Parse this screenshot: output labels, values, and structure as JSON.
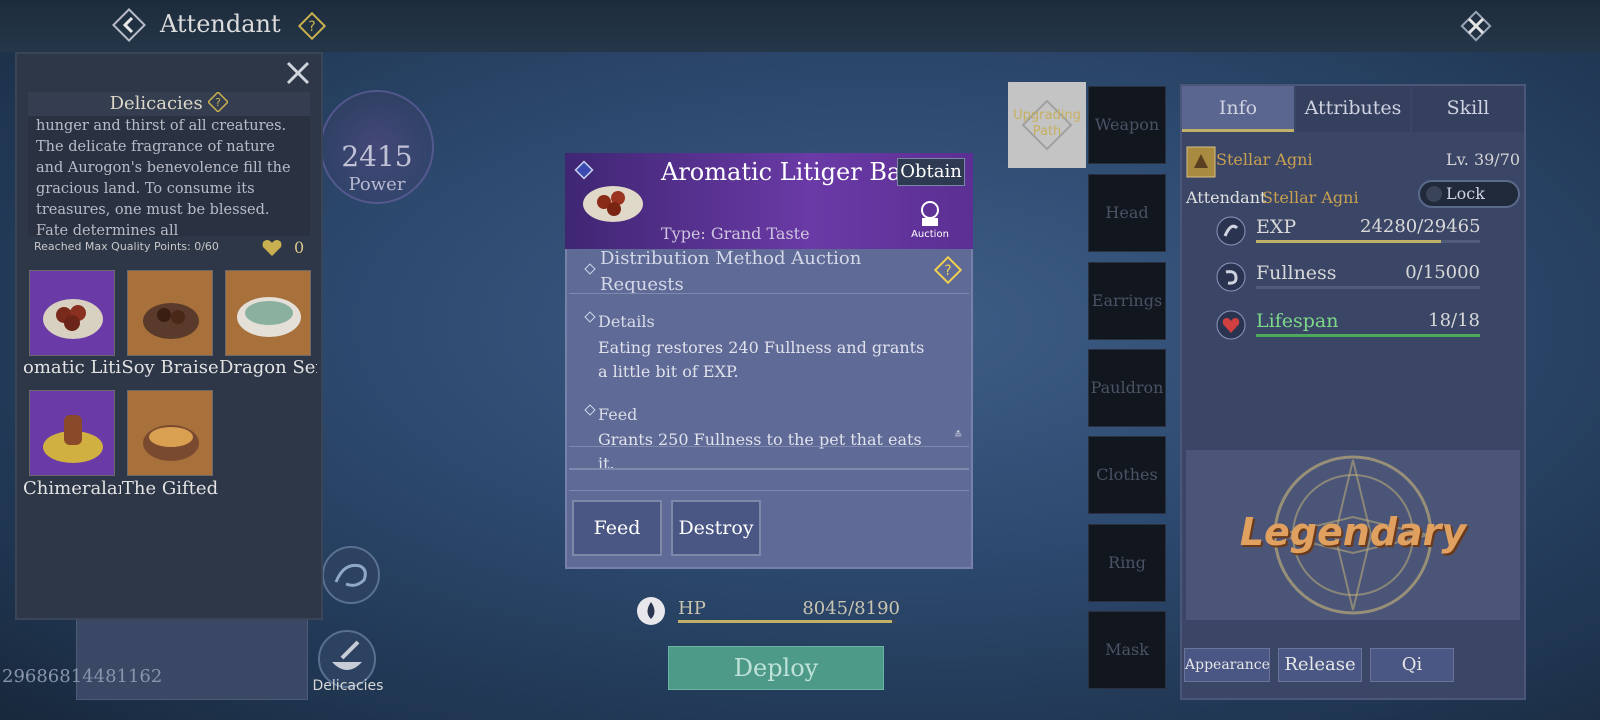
{
  "header": {
    "title": "Attendant"
  },
  "delicacies_panel": {
    "title": "Delicacies",
    "description": "hunger and thirst of all creatures. The delicate fragrance of nature and Aurogon's benevolence fill the gracious land. To consume its treasures, one must be blessed. Fate determines all",
    "reached_label": "Reached Max Quality Points: 0/60",
    "heart_count": "0",
    "items": [
      {
        "name": "omatic Litig"
      },
      {
        "name": "Soy Braise"
      },
      {
        "name": "Dragon Ser"
      },
      {
        "name": "Chimeralar"
      },
      {
        "name": "The Gifted"
      }
    ]
  },
  "power": {
    "value": "2415",
    "label": "Power"
  },
  "player_id": "29686814481162",
  "delicacies_button_label": "Delicacies",
  "item_popup": {
    "name": "Aromatic Litiger Ball",
    "obtain_label": "Obtain",
    "auction_label": "Auction",
    "type_text": "Type: Grand Taste",
    "distribution_text": "Distribution Method    Auction Requests",
    "details_heading": "Details",
    "details_body": "Eating restores 240 Fullness and grants a little bit of EXP.",
    "feed_heading": "Feed",
    "feed_body": "Grants 250 Fullness to the pet that eats it.",
    "feed_button": "Feed",
    "destroy_button": "Destroy"
  },
  "hp": {
    "label": "HP",
    "value": "8045/8190",
    "fraction": 0.982
  },
  "deploy_label": "Deploy",
  "equipment": {
    "upgrade_label": "Upgrading Path",
    "slots": [
      "Weapon",
      "Head",
      "Earrings",
      "Pauldron",
      "Clothes",
      "Ring",
      "Mask"
    ]
  },
  "info_panel": {
    "tabs": [
      "Info",
      "Attributes",
      "Skill"
    ],
    "active_tab": "Info",
    "pet_name": "Stellar Agni",
    "level": "Lv. 39/70",
    "attendant_label": "Attendant",
    "attendant_name": "Stellar Agni",
    "lock_label": "Lock",
    "stats": [
      {
        "name": "EXP",
        "value": "24280/29465",
        "fraction": 0.824,
        "color": "#c0b068"
      },
      {
        "name": "Fullness",
        "value": "0/15000",
        "fraction": 0.0,
        "color": "#c0b068"
      },
      {
        "name": "Lifespan",
        "value": "18/18",
        "fraction": 1.0,
        "color": "#4caa5c"
      }
    ],
    "rarity": "Legendary",
    "footer_buttons": [
      "Appearance",
      "Release",
      "Qi"
    ]
  }
}
